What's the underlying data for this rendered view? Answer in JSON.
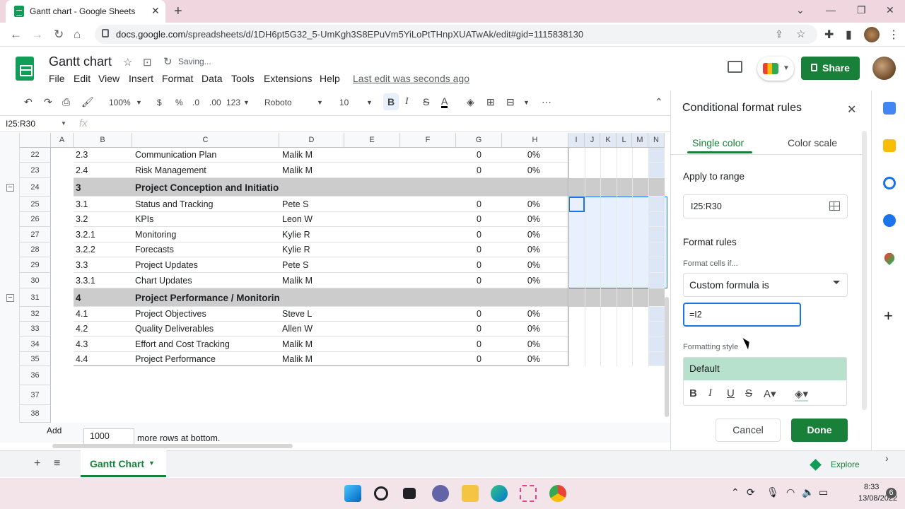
{
  "browser": {
    "tab_title": "Gantt chart - Google Sheets",
    "tab_close": "✕",
    "new_tab": "+",
    "url_host": "docs.google.com",
    "url_path": "/spreadsheets/d/1DH6pt5G32_5-UmKgh3S8EPuVm5YiLoPtTHnpXUATwAk/edit#gid=1115838130"
  },
  "sheets": {
    "doc_title": "Gantt chart",
    "saving": "Saving...",
    "last_edit": "Last edit was seconds ago",
    "share": "Share",
    "menus": [
      "File",
      "Edit",
      "View",
      "Insert",
      "Format",
      "Data",
      "Tools",
      "Extensions",
      "Help"
    ]
  },
  "toolbar": {
    "zoom": "100%",
    "currency": "$",
    "percent": "%",
    "dec_less": ".0",
    "dec_more": ".00",
    "format_more": "123",
    "font": "Roboto",
    "font_size": "10",
    "bold": "B",
    "italic": "I",
    "strike": "S",
    "text_color": "A",
    "more": "⋯"
  },
  "formula_bar": {
    "name_box": "I25:R30",
    "fx": "fx"
  },
  "columns": [
    "A",
    "B",
    "C",
    "D",
    "E",
    "F",
    "G",
    "H",
    "I",
    "J",
    "K",
    "L",
    "M",
    "N"
  ],
  "rows": [
    {
      "n": "22",
      "b": "2.3",
      "c": "Communication Plan",
      "d": "Malik M",
      "g": "0",
      "h": "0%"
    },
    {
      "n": "23",
      "b": "2.4",
      "c": "Risk Management",
      "d": "Malik M",
      "g": "0",
      "h": "0%"
    },
    {
      "n": "24",
      "b": "3",
      "c": "Project Conception and Initiation",
      "d": "",
      "g": "",
      "h": "",
      "section": true
    },
    {
      "n": "25",
      "b": "3.1",
      "c": "Status and Tracking",
      "d": "Pete S",
      "g": "0",
      "h": "0%"
    },
    {
      "n": "26",
      "b": "3.2",
      "c": "KPIs",
      "d": "Leon W",
      "g": "0",
      "h": "0%"
    },
    {
      "n": "27",
      "b": "3.2.1",
      "c": "Monitoring",
      "d": "Kylie R",
      "g": "0",
      "h": "0%"
    },
    {
      "n": "28",
      "b": "3.2.2",
      "c": "Forecasts",
      "d": "Kylie R",
      "g": "0",
      "h": "0%"
    },
    {
      "n": "29",
      "b": "3.3",
      "c": "Project Updates",
      "d": "Pete S",
      "g": "0",
      "h": "0%"
    },
    {
      "n": "30",
      "b": "3.3.1",
      "c": "Chart Updates",
      "d": "Malik M",
      "g": "0",
      "h": "0%"
    },
    {
      "n": "31",
      "b": "4",
      "c": "Project Performance / Monitoring",
      "d": "",
      "g": "",
      "h": "",
      "section": true
    },
    {
      "n": "32",
      "b": "4.1",
      "c": "Project Objectives",
      "d": "Steve L",
      "g": "0",
      "h": "0%"
    },
    {
      "n": "33",
      "b": "4.2",
      "c": "Quality Deliverables",
      "d": "Allen W",
      "g": "0",
      "h": "0%"
    },
    {
      "n": "34",
      "b": "4.3",
      "c": "Effort and Cost Tracking",
      "d": "Malik M",
      "g": "0",
      "h": "0%"
    },
    {
      "n": "35",
      "b": "4.4",
      "c": "Project Performance",
      "d": "Malik M",
      "g": "0",
      "h": "0%"
    },
    {
      "n": "36",
      "b": "",
      "c": "",
      "d": "",
      "g": "",
      "h": ""
    },
    {
      "n": "37",
      "b": "",
      "c": "",
      "d": "",
      "g": "",
      "h": ""
    },
    {
      "n": "38",
      "b": "",
      "c": "",
      "d": "",
      "g": "",
      "h": ""
    }
  ],
  "add_rows": {
    "button": "Add",
    "count": "1000",
    "suffix": "more rows at bottom."
  },
  "sheet_tab": {
    "name": "Gantt Chart"
  },
  "panel": {
    "title": "Conditional format rules",
    "tab_single": "Single color",
    "tab_scale": "Color scale",
    "apply_label": "Apply to range",
    "range": "I25:R30",
    "rules_label": "Format rules",
    "cells_if_label": "Format cells if...",
    "condition": "Custom formula is",
    "formula": "=I2",
    "style_label": "Formatting style",
    "style_default": "Default",
    "cancel": "Cancel",
    "done": "Done"
  },
  "explore": "Explore",
  "taskbar": {
    "time": "8:33",
    "date": "13/08/2022",
    "notif": "6"
  },
  "colors": {
    "accent": "#188038",
    "selection": "#e8f0fe",
    "section_row": "#cccccc",
    "style_green": "#b7e1cd"
  }
}
